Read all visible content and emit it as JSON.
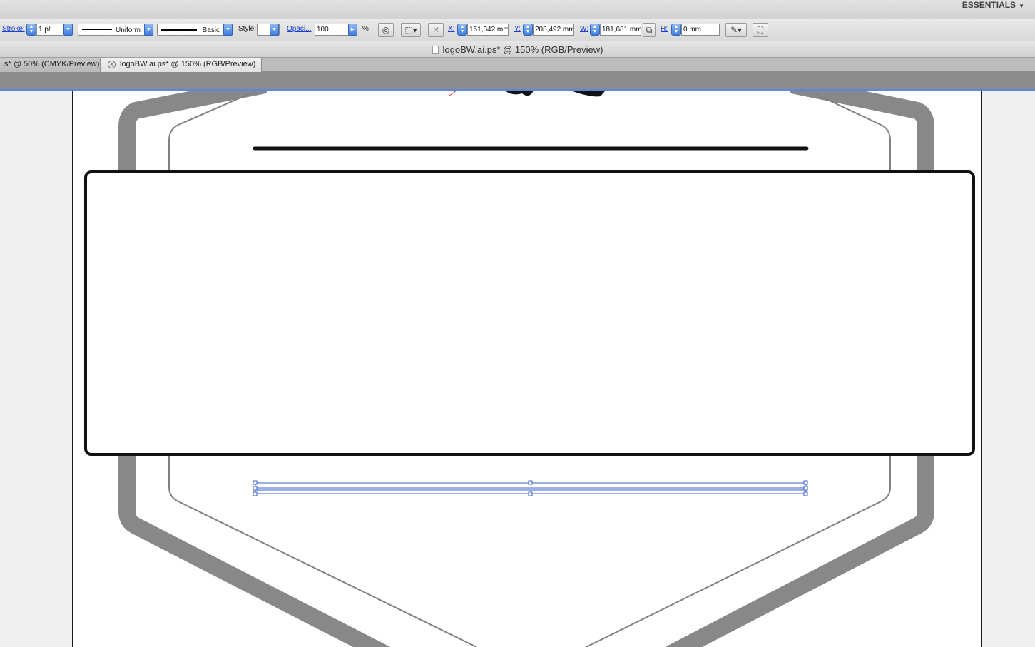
{
  "workspace": {
    "label": "ESSENTIALS"
  },
  "controlbar": {
    "stroke_label": "Stroke:",
    "stroke_weight": "1 pt",
    "variable_width": "Uniform",
    "brush": "Basic",
    "style_label": "Style:",
    "opacity_label": "Opaci...",
    "opacity_value": "100",
    "opacity_unit": "%",
    "x_label": "X:",
    "x_value": "151,342 mm",
    "y_label": "Y:",
    "y_value": "208,492 mm",
    "w_label": "W:",
    "w_value": "181,681 mm",
    "h_label": "H:",
    "h_value": "0 mm"
  },
  "document": {
    "title": "logoBW.ai.ps* @ 150% (RGB/Preview)"
  },
  "tabs": [
    {
      "label": "s* @ 50% (CMYK/Preview)",
      "active": false
    },
    {
      "label": "logoBW.ai.ps* @ 150% (RGB/Preview)",
      "active": true
    }
  ],
  "colors": {
    "ui_accent": "#3d7de0",
    "art_gray": "#888888",
    "art_outline": "#808080",
    "art_black": "#111111",
    "selection": "#3a5fcf"
  }
}
